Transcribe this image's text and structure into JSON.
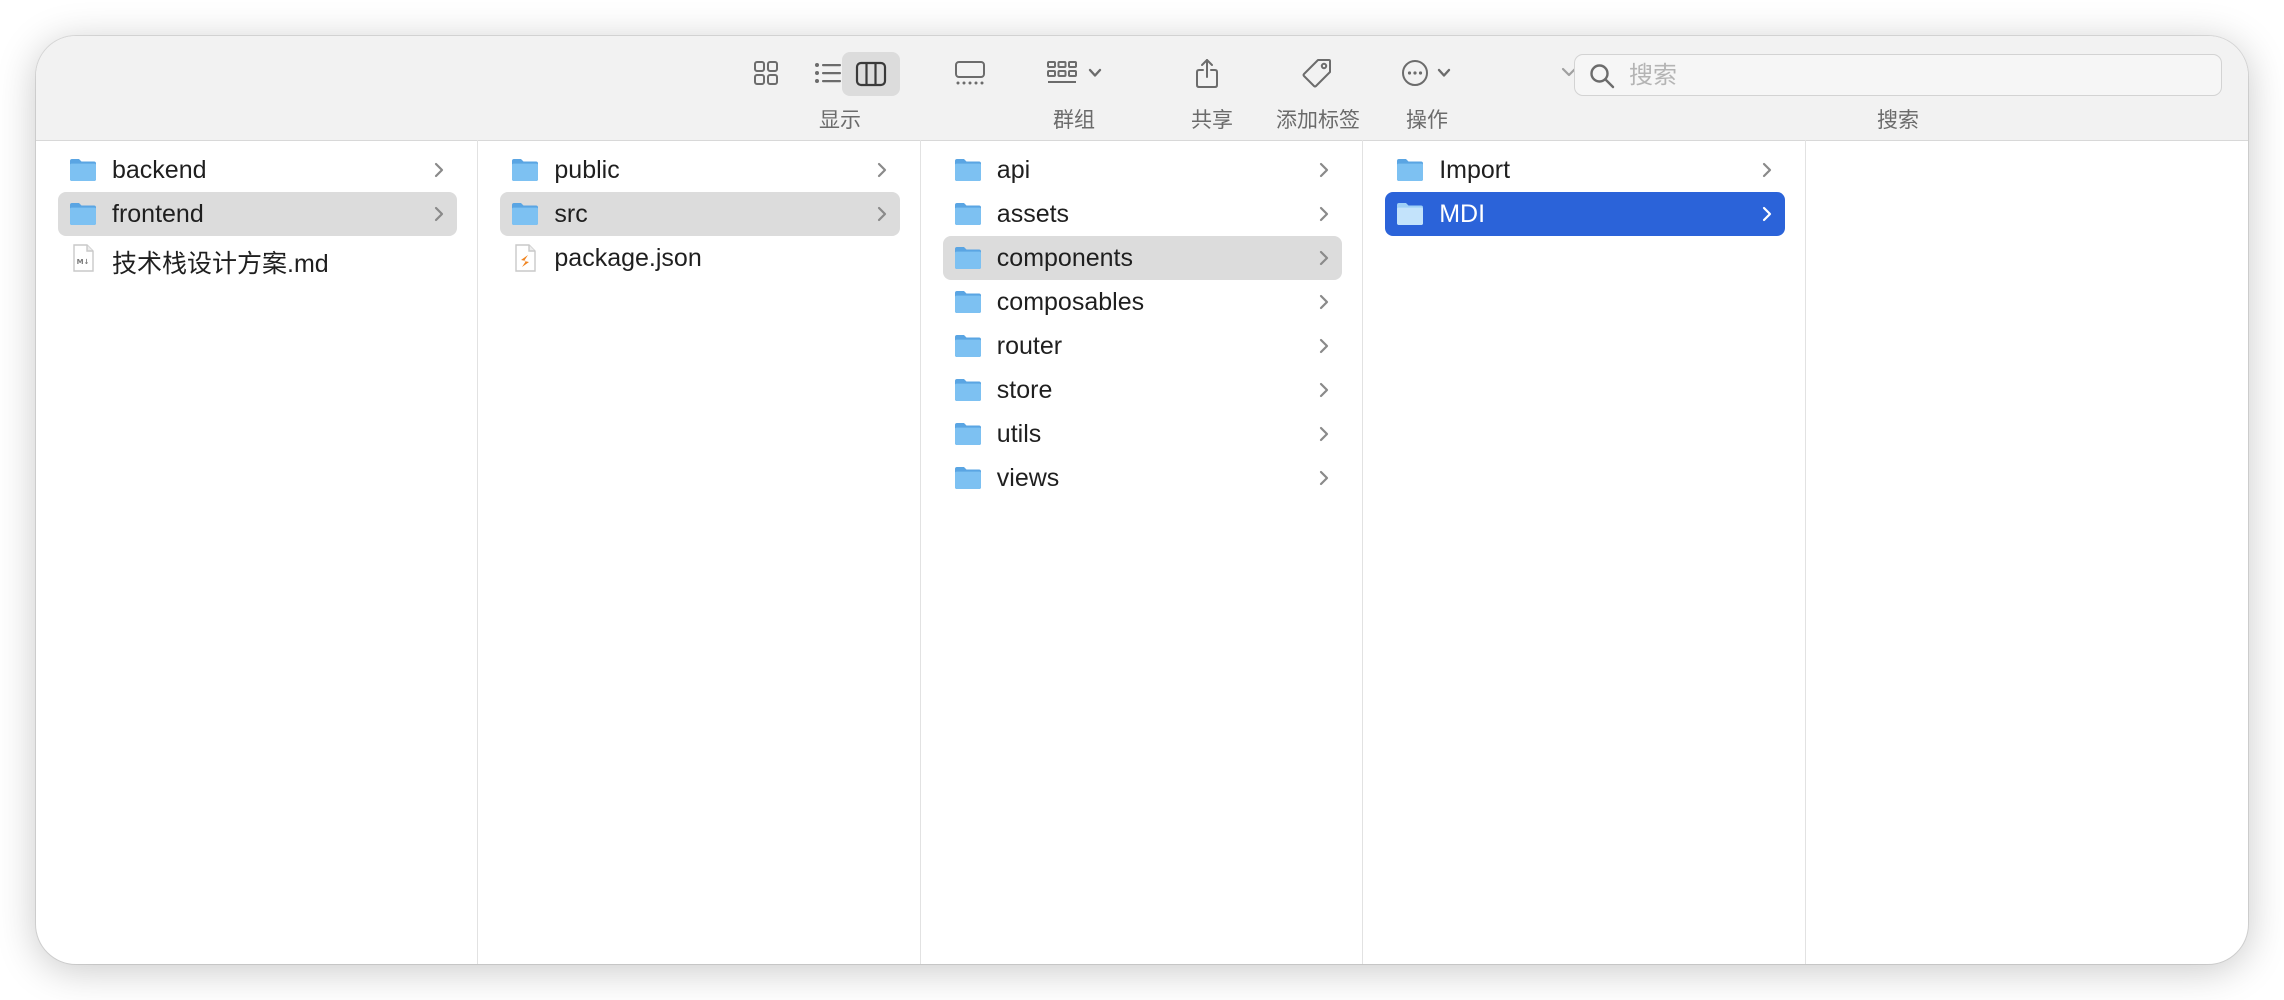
{
  "toolbar": {
    "view_group_label": "显示",
    "group_label": "群组",
    "share_label": "共享",
    "tag_label": "添加标签",
    "action_label": "操作",
    "search_label": "搜索",
    "search_placeholder": "搜索",
    "active_view": "columns"
  },
  "columns": [
    {
      "items": [
        {
          "name": "backend",
          "type": "folder",
          "has_children": true,
          "state": "none"
        },
        {
          "name": "frontend",
          "type": "folder",
          "has_children": true,
          "state": "path"
        },
        {
          "name": "技术栈设计方案.md",
          "type": "markdown-file",
          "has_children": false,
          "state": "none"
        }
      ]
    },
    {
      "items": [
        {
          "name": "public",
          "type": "folder",
          "has_children": true,
          "state": "none"
        },
        {
          "name": "src",
          "type": "folder",
          "has_children": true,
          "state": "path"
        },
        {
          "name": "package.json",
          "type": "json-file",
          "has_children": false,
          "state": "none"
        }
      ]
    },
    {
      "items": [
        {
          "name": "api",
          "type": "folder",
          "has_children": true,
          "state": "none"
        },
        {
          "name": "assets",
          "type": "folder",
          "has_children": true,
          "state": "none"
        },
        {
          "name": "components",
          "type": "folder",
          "has_children": true,
          "state": "path"
        },
        {
          "name": "composables",
          "type": "folder",
          "has_children": true,
          "state": "none"
        },
        {
          "name": "router",
          "type": "folder",
          "has_children": true,
          "state": "none"
        },
        {
          "name": "store",
          "type": "folder",
          "has_children": true,
          "state": "none"
        },
        {
          "name": "utils",
          "type": "folder",
          "has_children": true,
          "state": "none"
        },
        {
          "name": "views",
          "type": "folder",
          "has_children": true,
          "state": "none"
        }
      ]
    },
    {
      "items": [
        {
          "name": "Import",
          "type": "folder",
          "has_children": true,
          "state": "none"
        },
        {
          "name": "MDI",
          "type": "folder",
          "has_children": true,
          "state": "selected"
        }
      ]
    },
    {
      "items": []
    }
  ],
  "colors": {
    "selection_blue": "#2b63d9",
    "path_gray": "#dcdcdc",
    "folder_blue": "#6cb5ee",
    "toolbar_bg": "#f2f2f2"
  }
}
